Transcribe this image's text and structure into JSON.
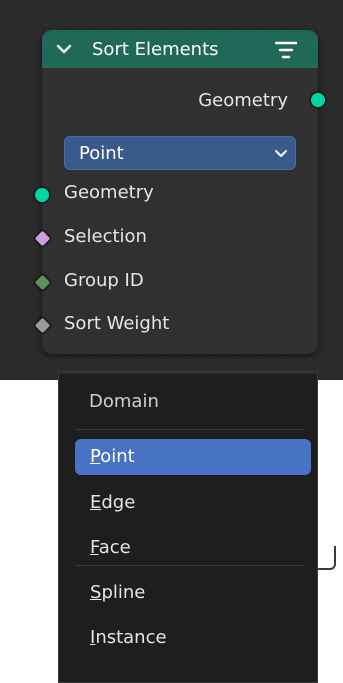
{
  "node": {
    "title": "Sort Elements",
    "output_geometry": "Geometry",
    "domain_value": "Point",
    "inputs": [
      "Geometry",
      "Selection",
      "Group ID",
      "Sort Weight"
    ],
    "colors": {
      "header": "#206858",
      "geometry_socket": "#00d6a3",
      "selection_socket": "#c9a0dc",
      "group_socket": "#5e8f5e",
      "weight_socket": "#9a9a9a"
    }
  },
  "menu": {
    "title": "Domain",
    "items": [
      "Point",
      "Edge",
      "Face",
      "Spline",
      "Instance"
    ],
    "underlines": [
      "P",
      "E",
      "F",
      "S",
      "I"
    ],
    "rests": [
      "oint",
      "dge",
      "ace",
      "pline",
      "nstance"
    ],
    "selected": "Point"
  }
}
